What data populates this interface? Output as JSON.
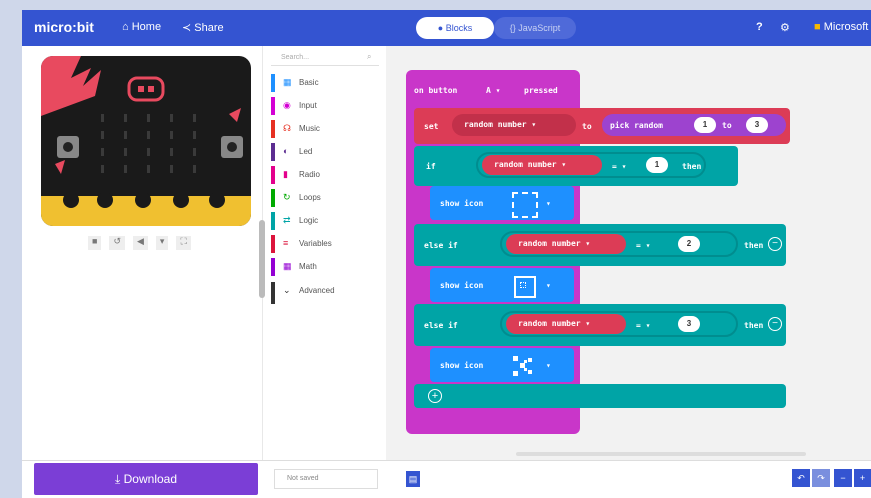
{
  "topbar": {
    "brand": "micro:bit",
    "home_label": "Home",
    "share_label": "Share",
    "blocks_label": "Blocks",
    "javascript_label": "JavaScript",
    "microsoft_label": "Microsoft"
  },
  "colors": {
    "topbar": "#3454d1",
    "event": "#c936c9",
    "variables": "#dc3c56",
    "logic": "#00a4a6",
    "basic": "#1e90ff",
    "math": "#9d43cf",
    "download": "#7b3ed6"
  },
  "simulator": {
    "controls": [
      "■",
      "↺",
      "◀",
      "▾",
      "⛶"
    ]
  },
  "toolbox": {
    "search_placeholder": "Search...",
    "categories": [
      {
        "label": "Basic",
        "color": "#1e90ff",
        "icon": "grid-icon"
      },
      {
        "label": "Input",
        "color": "#d400d4",
        "icon": "circle-dot-icon"
      },
      {
        "label": "Music",
        "color": "#e63022",
        "icon": "headphones-icon"
      },
      {
        "label": "Led",
        "color": "#5c2d91",
        "icon": "toggle-icon"
      },
      {
        "label": "Radio",
        "color": "#e3008c",
        "icon": "bars-icon"
      },
      {
        "label": "Loops",
        "color": "#00aa00",
        "icon": "refresh-icon"
      },
      {
        "label": "Logic",
        "color": "#00a4a6",
        "icon": "shuffle-icon"
      },
      {
        "label": "Variables",
        "color": "#dc143c",
        "icon": "list-icon"
      },
      {
        "label": "Math",
        "color": "#9400d3",
        "icon": "calculator-icon"
      }
    ],
    "advanced_label": "Advanced"
  },
  "blocks": {
    "event_label": "on button",
    "event_button": "A ▾",
    "event_pressed": "pressed",
    "set_label": "set",
    "var_name": "random number ▾",
    "to_label": "to",
    "pick_random_label": "pick random",
    "pick_from": "1",
    "pick_to_label": "to",
    "pick_to": "3",
    "if_label": "if",
    "eq_label": "= ▾",
    "then_label": "then",
    "else_if_label": "else if",
    "show_icon_label": "show icon",
    "cond_values": [
      "1",
      "2",
      "3"
    ],
    "dropdown_arrow": "▾"
  },
  "bottombar": {
    "download_label": "Download",
    "project_name": "Not saved"
  }
}
